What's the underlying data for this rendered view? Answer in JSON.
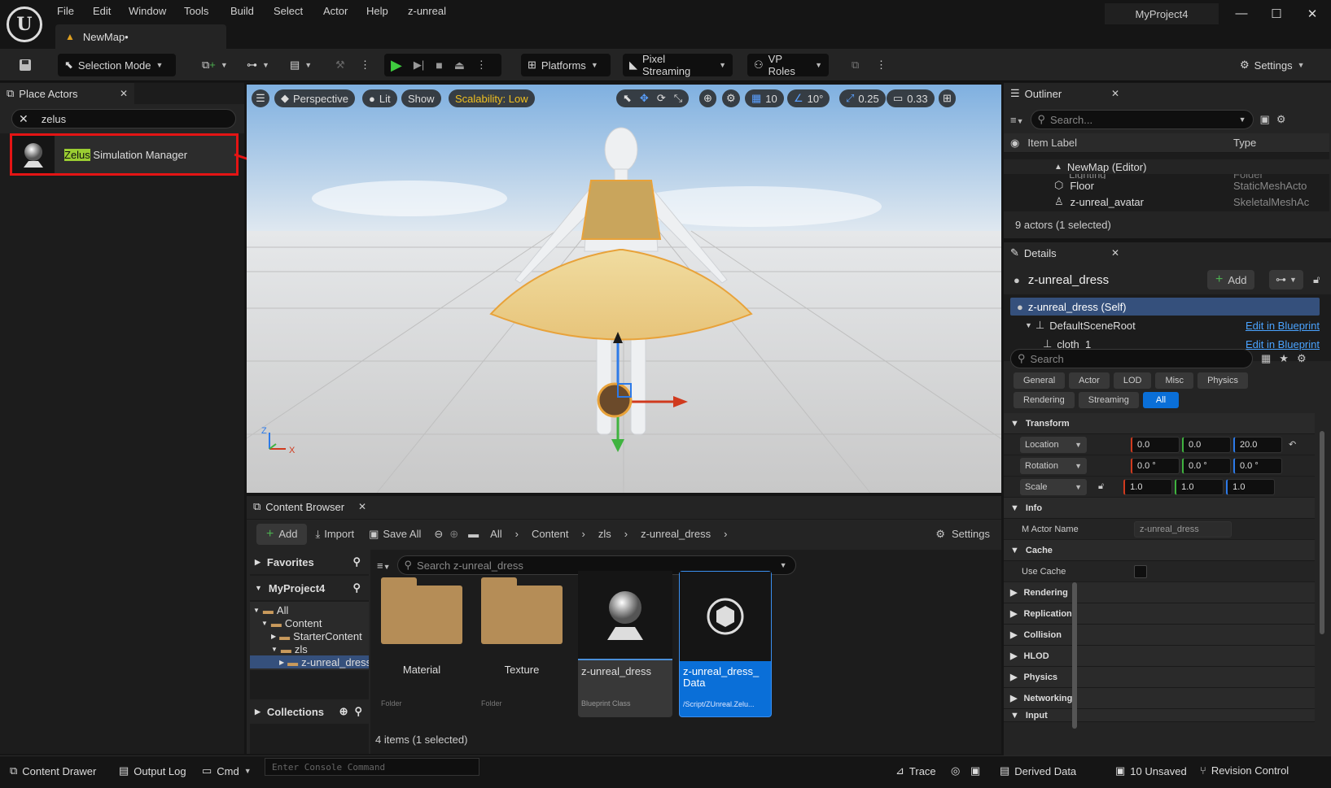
{
  "menu": [
    "File",
    "Edit",
    "Window",
    "Tools",
    "Build",
    "Select",
    "Actor",
    "Help",
    "z-unreal"
  ],
  "document_tab": "NewMap•",
  "project_name": "MyProject4",
  "toolbar": {
    "selection_mode": "Selection Mode",
    "platforms": "Platforms",
    "pixel_streaming": "Pixel Streaming",
    "vp_roles": "VP Roles",
    "settings": "Settings"
  },
  "place_actors": {
    "title": "Place Actors",
    "search_value": "zelus",
    "result_highlight": "Zelus",
    "result_rest": " Simulation Manager"
  },
  "viewport": {
    "perspective": "Perspective",
    "lit": "Lit",
    "show": "Show",
    "scalability": "Scalability: Low",
    "grid_size": "10",
    "angle_snap": "10°",
    "scale_snap": "0.25",
    "camera_speed": "0.33",
    "axis_z": "Z",
    "axis_x": "X"
  },
  "outliner": {
    "title": "Outliner",
    "search_placeholder": "Search...",
    "col_label": "Item Label",
    "col_type": "Type",
    "rows": [
      {
        "label": "NewMap (Editor)",
        "type": ""
      },
      {
        "label": "Lighting",
        "type": "Folder"
      },
      {
        "label": "Floor",
        "type": "StaticMeshActo"
      },
      {
        "label": "z-unreal_avatar",
        "type": "SkeletalMeshAc"
      }
    ],
    "status": "9 actors (1 selected)"
  },
  "details": {
    "title": "Details",
    "actor_name": "z-unreal_dress",
    "add_label": "Add",
    "components": [
      {
        "label": "z-unreal_dress (Self)",
        "link": ""
      },
      {
        "label": "DefaultSceneRoot",
        "link": "Edit in Blueprint"
      },
      {
        "label": "cloth_1",
        "link": "Edit in Blueprint"
      }
    ],
    "search_placeholder": "Search",
    "categories_row1": [
      "General",
      "Actor",
      "LOD",
      "Misc",
      "Physics"
    ],
    "categories_row2": [
      "Rendering",
      "Streaming",
      "All"
    ],
    "transform_header": "Transform",
    "location_label": "Location",
    "rotation_label": "Rotation",
    "scale_label": "Scale",
    "location": [
      "0.0",
      "0.0",
      "20.0"
    ],
    "rotation": [
      "0.0 °",
      "0.0 °",
      "0.0 °"
    ],
    "scale": [
      "1.0",
      "1.0",
      "1.0"
    ],
    "info_header": "Info",
    "m_actor_name_label": "M Actor Name",
    "m_actor_name_value": "z-unreal_dress",
    "cache_header": "Cache",
    "use_cache_label": "Use Cache",
    "collapsed_sections": [
      "Rendering",
      "Replication",
      "Collision",
      "HLOD",
      "Physics",
      "Networking",
      "Input"
    ]
  },
  "content_browser": {
    "title": "Content Browser",
    "add_label": "Add",
    "import_label": "Import",
    "save_all_label": "Save All",
    "breadcrumb": [
      "All",
      "Content",
      "zls",
      "z-unreal_dress"
    ],
    "settings_label": "Settings",
    "favorites_label": "Favorites",
    "project_label": "MyProject4",
    "tree": [
      "All",
      "Content",
      "StarterContent",
      "zls",
      "z-unreal_dress"
    ],
    "collections_label": "Collections",
    "search_placeholder": "Search z-unreal_dress",
    "assets": [
      {
        "name": "Material",
        "type": "Folder"
      },
      {
        "name": "Texture",
        "type": "Folder"
      },
      {
        "name": "z-unreal_dress",
        "type": "Blueprint Class"
      },
      {
        "name": "z-unreal_dress_ Data",
        "type": "/Script/ZUnreal.Zelu..."
      }
    ],
    "status": "4 items (1 selected)"
  },
  "statusbar": {
    "content_drawer": "Content Drawer",
    "output_log": "Output Log",
    "cmd": "Cmd",
    "console_placeholder": "Enter Console Command",
    "trace": "Trace",
    "derived_data": "Derived Data",
    "unsaved": "10 Unsaved",
    "revision_control": "Revision Control"
  },
  "colors": {
    "accent_blue": "#0a6fd8",
    "highlight_red": "#e41414",
    "selection_yellow": "#d7b04a"
  }
}
